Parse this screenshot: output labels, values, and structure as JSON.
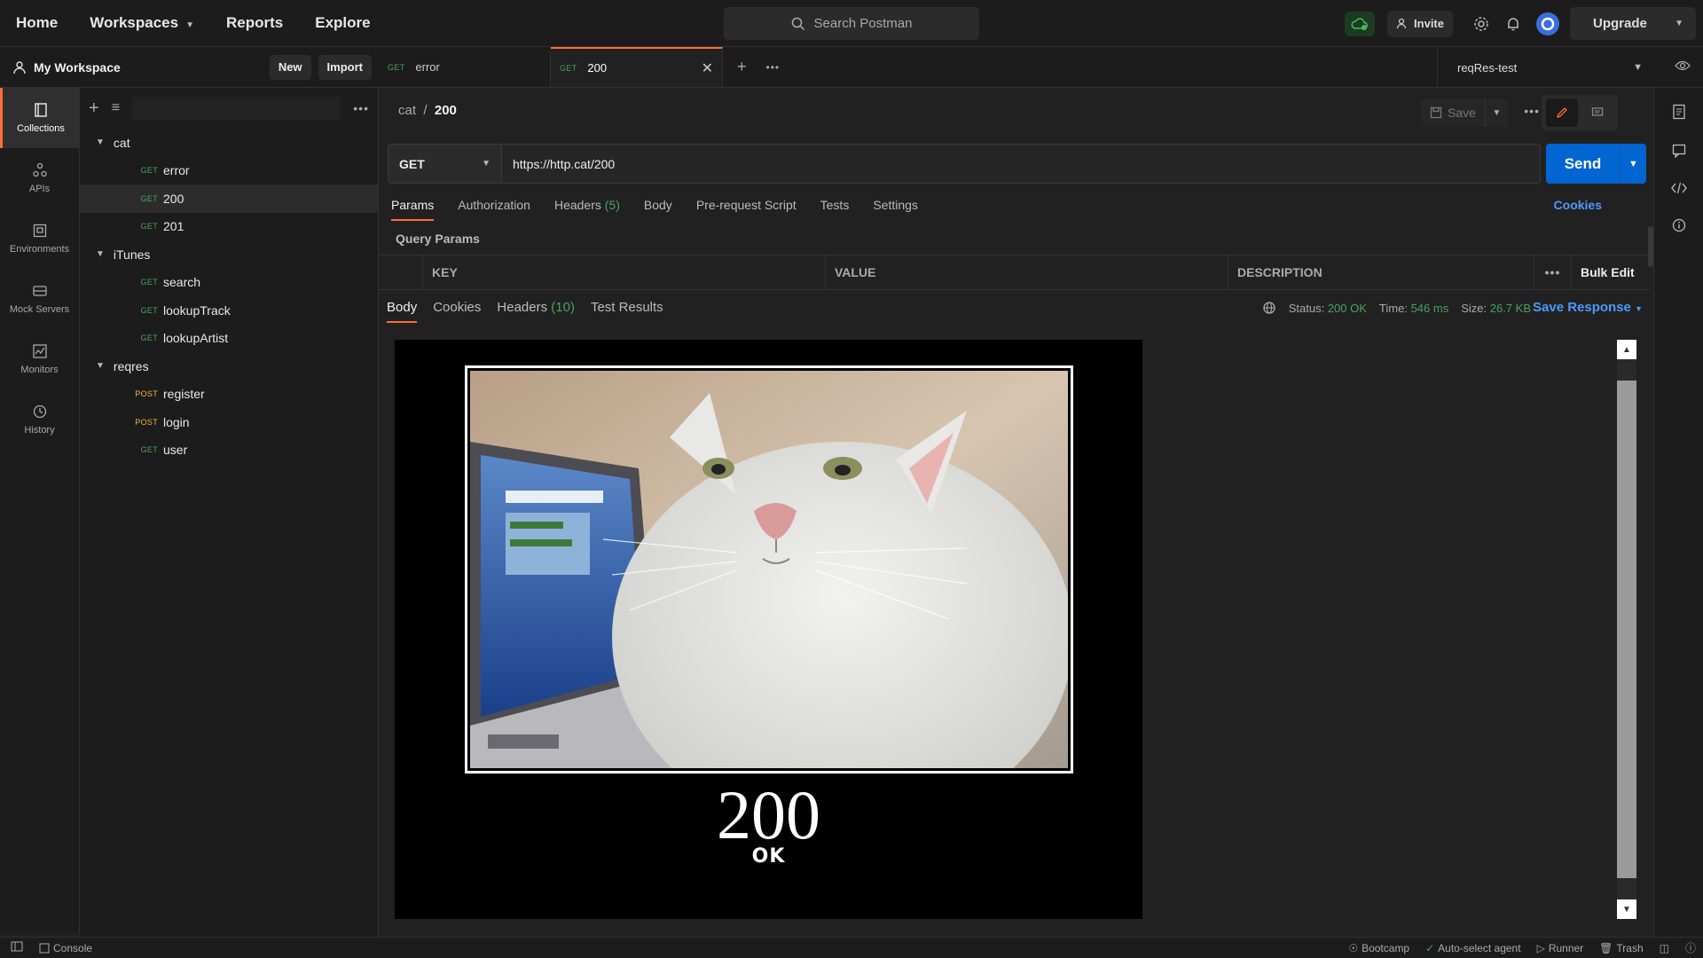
{
  "topbar": {
    "nav": [
      "Home",
      "Workspaces",
      "Reports",
      "Explore"
    ],
    "search_placeholder": "Search Postman",
    "invite": "Invite",
    "upgrade": "Upgrade"
  },
  "workspace": {
    "title": "My Workspace",
    "new_label": "New",
    "import_label": "Import"
  },
  "rail": [
    {
      "label": "Collections",
      "icon": "collections-icon"
    },
    {
      "label": "APIs",
      "icon": "apis-icon"
    },
    {
      "label": "Environments",
      "icon": "environments-icon"
    },
    {
      "label": "Mock Servers",
      "icon": "mock-servers-icon"
    },
    {
      "label": "Monitors",
      "icon": "monitors-icon"
    },
    {
      "label": "History",
      "icon": "history-icon"
    }
  ],
  "collections": [
    {
      "name": "cat",
      "requests": [
        {
          "method": "GET",
          "name": "error"
        },
        {
          "method": "GET",
          "name": "200"
        },
        {
          "method": "GET",
          "name": "201"
        }
      ]
    },
    {
      "name": "iTunes",
      "requests": [
        {
          "method": "GET",
          "name": "search"
        },
        {
          "method": "GET",
          "name": "lookupTrack"
        },
        {
          "method": "GET",
          "name": "lookupArtist"
        }
      ]
    },
    {
      "name": "reqres",
      "requests": [
        {
          "method": "POST",
          "name": "register"
        },
        {
          "method": "POST",
          "name": "login"
        },
        {
          "method": "GET",
          "name": "user"
        }
      ]
    }
  ],
  "tabs": [
    {
      "method": "GET",
      "name": "error"
    },
    {
      "method": "GET",
      "name": "200"
    }
  ],
  "environment": "reqRes-test",
  "request": {
    "breadcrumb_parent": "cat",
    "breadcrumb_sep": "/",
    "breadcrumb_current": "200",
    "save_label": "Save",
    "method": "GET",
    "url": "https://http.cat/200",
    "send_label": "Send",
    "tabs": {
      "params": "Params",
      "authorization": "Authorization",
      "headers": "Headers",
      "headers_count": "(5)",
      "body": "Body",
      "prerequest": "Pre-request Script",
      "tests": "Tests",
      "settings": "Settings"
    },
    "cookies": "Cookies",
    "query_params_label": "Query Params",
    "table_headers": {
      "key": "KEY",
      "value": "VALUE",
      "description": "DESCRIPTION",
      "bulk_edit": "Bulk Edit"
    }
  },
  "response": {
    "tabs": {
      "body": "Body",
      "cookies": "Cookies",
      "headers": "Headers",
      "headers_count": "(10)",
      "test_results": "Test Results"
    },
    "status_label": "Status:",
    "status_value": "200 OK",
    "time_label": "Time:",
    "time_value": "546 ms",
    "size_label": "Size:",
    "size_value": "26.7 KB",
    "save_response": "Save Response",
    "image_code": "200",
    "image_text": "OK"
  },
  "statusbar": {
    "console": "Console",
    "bootcamp": "Bootcamp",
    "agent": "Auto-select agent",
    "runner": "Runner",
    "trash": "Trash"
  },
  "colors": {
    "accent": "#ff6c37",
    "send": "#0265d2",
    "get": "#49a25f",
    "post": "#f4b43c",
    "link": "#4a9aff"
  }
}
